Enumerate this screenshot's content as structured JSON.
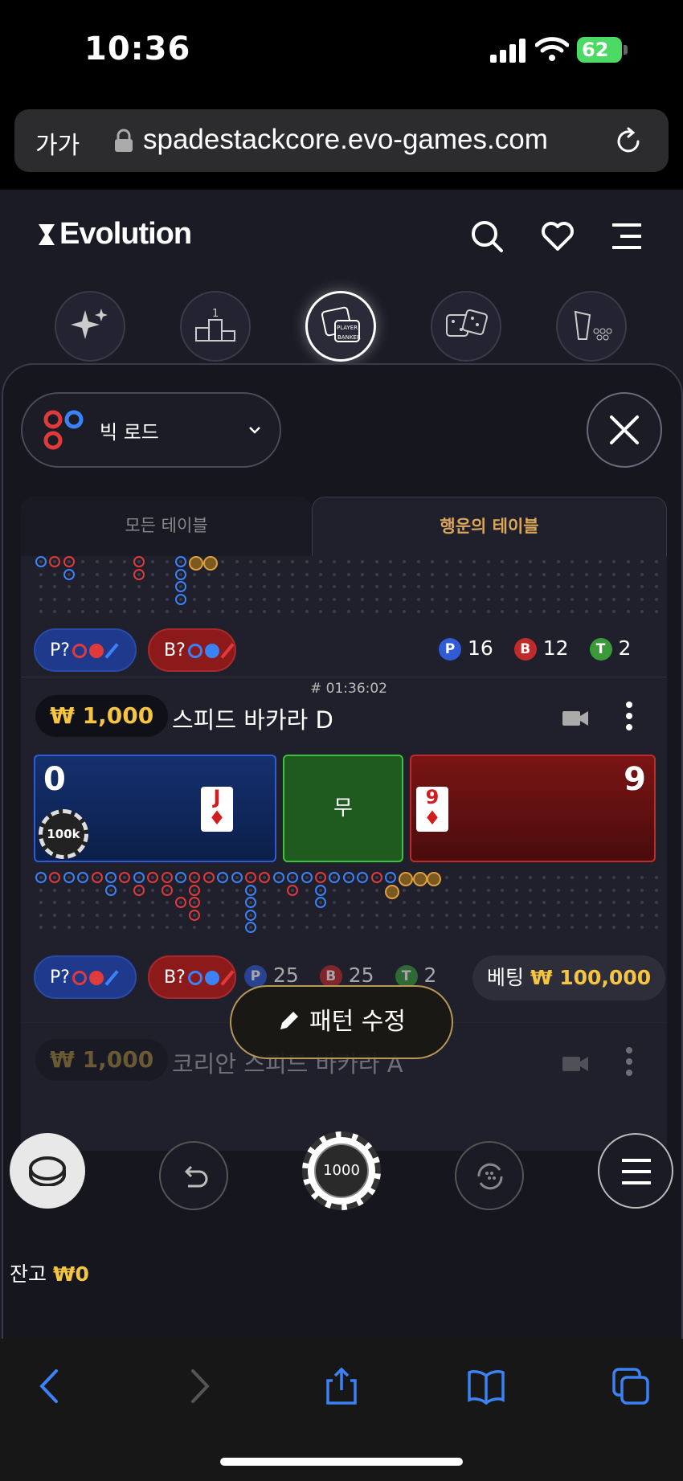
{
  "status_bar": {
    "time": "10:36",
    "battery": "62"
  },
  "browser": {
    "text_size": "가가",
    "url": "spadestackcore.evo-games.com"
  },
  "header": {
    "brand": "Evolution"
  },
  "categories": [
    "favorites-sparkle",
    "leaderboard",
    "baccarat",
    "dice",
    "game-shows"
  ],
  "road_selector": {
    "label": "빅 로드"
  },
  "tabs": {
    "all": "모든 테이블",
    "lucky": "행운의 테이블"
  },
  "first_table": {
    "player_predict": "P?",
    "banker_predict": "B?",
    "counts": {
      "p_label": "P",
      "p": "16",
      "b_label": "B",
      "b": "12",
      "t_label": "T",
      "t": "2"
    }
  },
  "table": {
    "id": "# 01:36:02",
    "min_bet": "₩ 1,000",
    "name": "스피드 바카라 D",
    "player_score": "0",
    "banker_score": "9",
    "tie_label": "무",
    "player_card": "J",
    "banker_card": "9",
    "chip_label": "100k",
    "player_predict": "P?",
    "banker_predict": "B?",
    "counts": {
      "p_label": "P",
      "p": "25",
      "b_label": "B",
      "b": "25",
      "t_label": "T",
      "t": "2"
    },
    "bet_label": "베팅",
    "bet_value": "₩ 100,000"
  },
  "next_table": {
    "min_bet": "₩ 1,000",
    "name": "코리안 스피드 바카라 A"
  },
  "edit_pattern": "패턴 수정",
  "chip_value": "1000",
  "balance": {
    "label": "잔고",
    "value": "₩0"
  },
  "colors": {
    "gold": "#f5c542",
    "player": "#3b82f6",
    "banker": "#e03a3a",
    "tie": "#3bc43b"
  }
}
